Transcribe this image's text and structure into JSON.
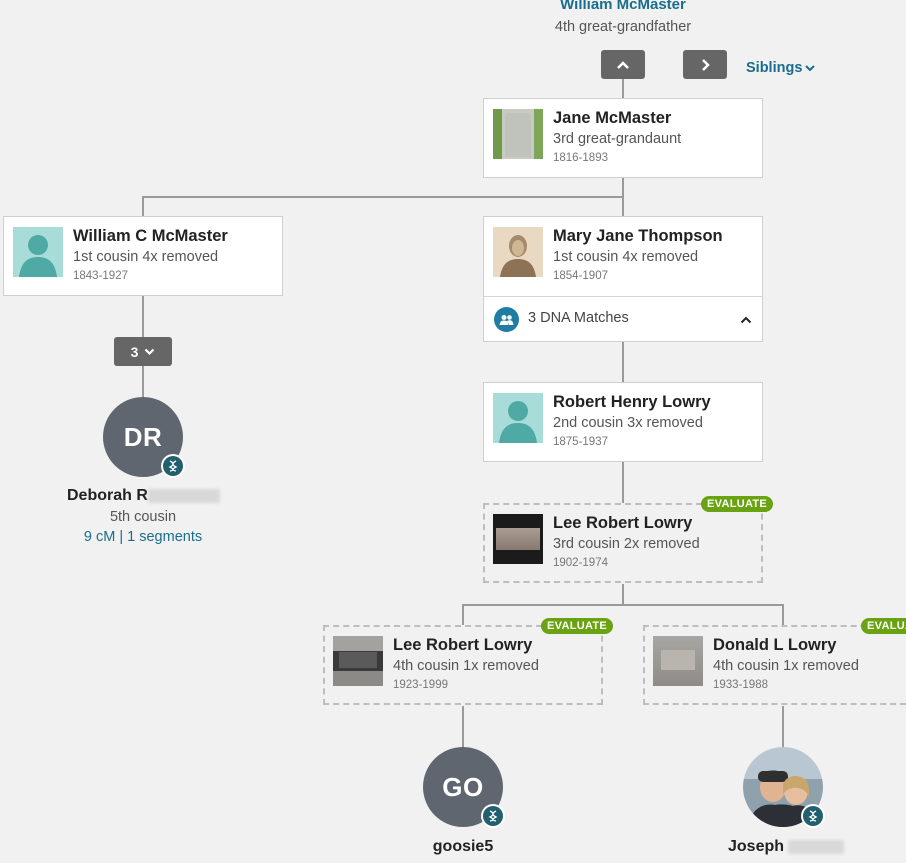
{
  "ancestor": {
    "name": "William McMaster",
    "relationship": "4th great-grandfather"
  },
  "nav": {
    "siblings_label": "Siblings"
  },
  "people": {
    "jane": {
      "name": "Jane McMaster",
      "relationship": "3rd great-grandaunt",
      "dates": "1816-1893",
      "photo": "headstone-photo"
    },
    "william_c": {
      "name": "William C McMaster",
      "relationship": "1st cousin 4x removed",
      "dates": "1843-1927",
      "photo": "silhouette-icon"
    },
    "mary_jane": {
      "name": "Mary Jane Thompson",
      "relationship": "1st cousin 4x removed",
      "dates": "1854-1907",
      "photo": "portrait-photo",
      "dna_matches": "3 DNA Matches"
    },
    "robert_henry": {
      "name": "Robert Henry Lowry",
      "relationship": "2nd cousin 3x removed",
      "dates": "1875-1937",
      "photo": "silhouette-icon"
    },
    "lee_robert_1": {
      "name": "Lee Robert Lowry",
      "relationship": "3rd cousin 2x removed",
      "dates": "1902-1974",
      "badge": "EVALUATE",
      "photo": "headstone-photo"
    },
    "lee_robert_2": {
      "name": "Lee Robert Lowry",
      "relationship": "4th cousin 1x removed",
      "dates": "1923-1999",
      "badge": "EVALUATE",
      "photo": "headstone-photo"
    },
    "donald": {
      "name": "Donald L Lowry",
      "relationship": "4th cousin 1x removed",
      "dates": "1933-1988",
      "badge": "EVALUATE",
      "photo": "headstone-photo"
    }
  },
  "collapsed_count": "3",
  "matches": {
    "deborah": {
      "initials": "DR",
      "name_visible": "Deborah R",
      "relationship": "5th cousin",
      "cm": "9 cM",
      "separator": "|",
      "segments": "1 segments"
    },
    "goosie": {
      "initials": "GO",
      "name": "goosie5"
    },
    "joseph": {
      "name_visible": "Joseph ",
      "photo": "couple-selfie-photo"
    }
  },
  "colors": {
    "link": "#1a6d8c",
    "badge": "#6aa312",
    "avatar": "#5f6670",
    "dna_badge": "#22606f",
    "button": "#666666"
  },
  "icons": [
    "chevron-up-icon",
    "chevron-right-icon",
    "chevron-down-icon",
    "dna-icon",
    "dna-matches-icon",
    "silhouette-icon"
  ]
}
